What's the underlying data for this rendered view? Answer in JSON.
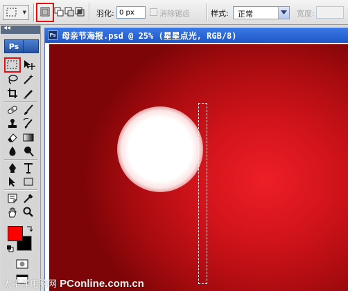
{
  "options_bar": {
    "feather_label": "羽化:",
    "feather_value": "0 px",
    "antialias_label": "消除锯齿",
    "style_label": "样式:",
    "style_value": "正常",
    "width_label": "宽度:"
  },
  "toolbox": {
    "collapse_arrows": "◂◂",
    "logo": "Ps"
  },
  "document": {
    "title": "母亲节海报.psd @ 25% (星星点光, RGB/8)",
    "doc_icon": "Ps"
  },
  "colors": {
    "foreground": "#ff0000",
    "background": "#000000",
    "highlight": "#e01010",
    "canvas": "#d0131a"
  },
  "watermark": {
    "cn": "太平洋电脑网",
    "brand": "PConline.com.cn"
  }
}
